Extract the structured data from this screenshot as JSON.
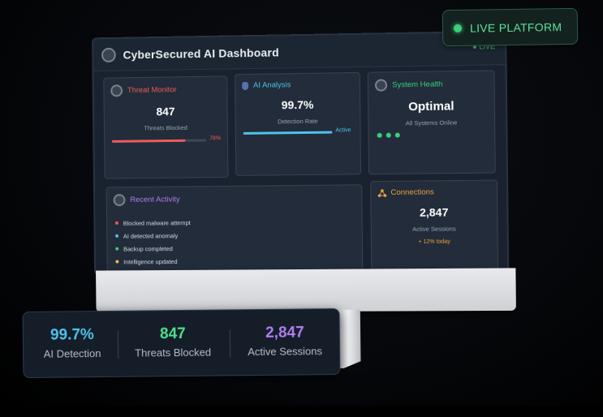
{
  "badge": {
    "label": "LIVE PLATFORM",
    "color": "#3ad07a"
  },
  "window": {
    "title": "CyberSecured AI Dashboard",
    "status": "LIVE"
  },
  "cards": {
    "threat_monitor": {
      "label": "Threat Monitor",
      "value": "847",
      "caption": "Threats Blocked",
      "progress_text": "78%",
      "progress": 0.78,
      "color": "#ee5b5b"
    },
    "ai_analysis": {
      "label": "AI Analysis",
      "value": "99.7%",
      "caption": "Detection Rate",
      "status": "Active",
      "color": "#4cc3ea"
    },
    "system_health": {
      "label": "System Health",
      "value": "Optimal",
      "caption": "All Systems Online",
      "color": "#3ad07a"
    },
    "recent_activity": {
      "label": "Recent Activity",
      "items": [
        {
          "text": "Blocked malware attempt",
          "color": "#ee5b5b"
        },
        {
          "text": "AI detected anomaly",
          "color": "#4cc3ea"
        },
        {
          "text": "Backup completed",
          "color": "#3ad07a"
        },
        {
          "text": "Intelligence updated",
          "color": "#f5b942"
        }
      ],
      "color": "#b07ef0"
    },
    "connections": {
      "label": "Connections",
      "value": "2,847",
      "caption": "Active Sessions",
      "trend": "+ 12% today",
      "color": "#f0a040"
    }
  },
  "stats": [
    {
      "value": "99.7%",
      "label": "AI Detection",
      "color": "#4cc3ea"
    },
    {
      "value": "847",
      "label": "Threats Blocked",
      "color": "#4ee08a"
    },
    {
      "value": "2,847",
      "label": "Active Sessions",
      "color": "#b07ef0"
    }
  ]
}
